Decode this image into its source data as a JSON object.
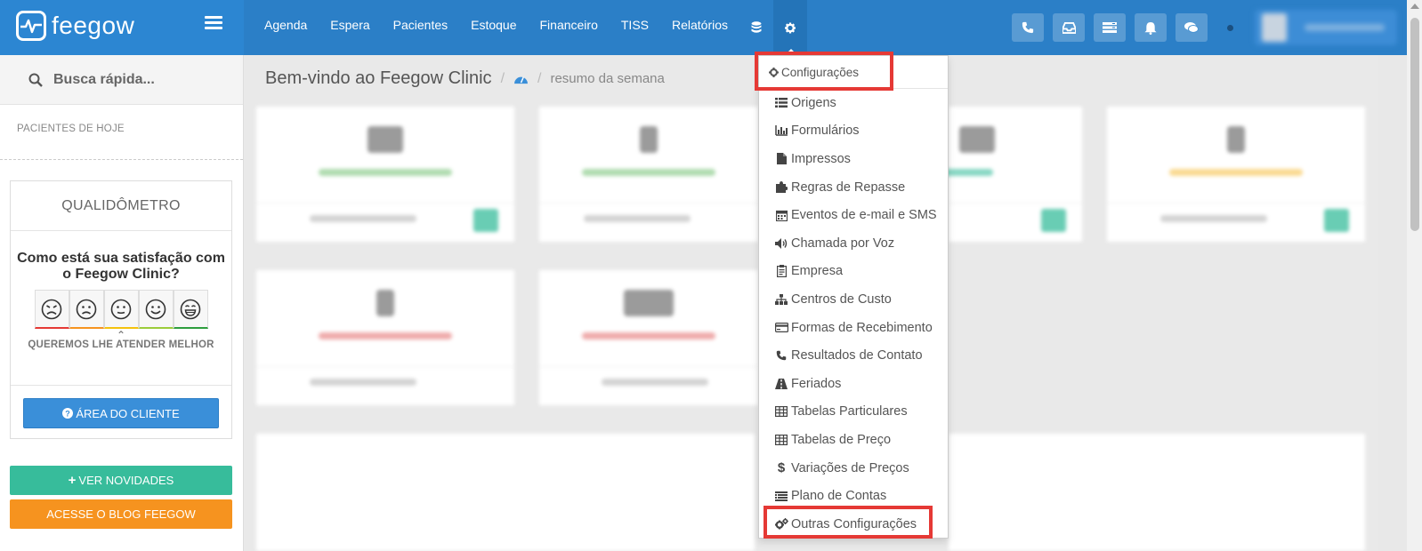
{
  "brand": {
    "name": "feegow"
  },
  "nav": {
    "items": [
      "Agenda",
      "Espera",
      "Pacientes",
      "Estoque",
      "Financeiro",
      "TISS",
      "Relatórios"
    ],
    "database_icon": "database-icon",
    "settings_icon": "gear-icon"
  },
  "topbar_icons": [
    "phone-icon",
    "inbox-icon",
    "list-icon",
    "bell-icon",
    "chat-icon"
  ],
  "sidebar": {
    "search_placeholder": "Busca rápida...",
    "today_patients_label": "PACIENTES DE HOJE",
    "qualimeter": {
      "title": "QUALIDÔMETRO",
      "question": "Como está sua satisfação com o Feegow Clinic?",
      "faces": [
        "very-dissatisfied",
        "dissatisfied",
        "neutral",
        "satisfied",
        "very-satisfied"
      ],
      "face_colors": [
        "#e53935",
        "#f6931f",
        "#f4c20d",
        "#9ccc3a",
        "#2e9e3e"
      ],
      "subtitle": "QUEREMOS LHE ATENDER MELHOR",
      "client_area_label": "ÁREA DO CLIENTE"
    },
    "news_label": "VER NOVIDADES",
    "blog_label": "ACESSE O BLOG FEEGOW"
  },
  "breadcrumb": {
    "title": "Bem-vindo ao Feegow Clinic",
    "subtitle": "resumo da semana"
  },
  "settings_menu": {
    "header": "Configurações",
    "items": [
      {
        "label": "Origens",
        "icon": "list-icon"
      },
      {
        "label": "Formulários",
        "icon": "bar-chart-icon"
      },
      {
        "label": "Impressos",
        "icon": "file-icon"
      },
      {
        "label": "Regras de Repasse",
        "icon": "puzzle-icon"
      },
      {
        "label": "Eventos de e-mail e SMS",
        "icon": "calendar-icon"
      },
      {
        "label": "Chamada por Voz",
        "icon": "volume-icon"
      },
      {
        "label": "Empresa",
        "icon": "clipboard-icon"
      },
      {
        "label": "Centros de Custo",
        "icon": "sitemap-icon"
      },
      {
        "label": "Formas de Recebimento",
        "icon": "credit-card-icon"
      },
      {
        "label": "Resultados de Contato",
        "icon": "phone-icon"
      },
      {
        "label": "Feriados",
        "icon": "road-icon"
      },
      {
        "label": "Tabelas Particulares",
        "icon": "table-icon"
      },
      {
        "label": "Tabelas de Preço",
        "icon": "table-icon"
      },
      {
        "label": "Variações de Preços",
        "icon": "dollar-icon"
      },
      {
        "label": "Plano de Contas",
        "icon": "list-alt-icon"
      },
      {
        "label": "Outras Configurações",
        "icon": "cogs-icon"
      }
    ],
    "highlighted": [
      "Configurações",
      "Outras Configurações"
    ],
    "highlight_color": "#e53935"
  },
  "colors": {
    "topbar": "#2b7fc7",
    "primary_button": "#3a8fd9",
    "success_button": "#37bc9b",
    "warning_button": "#f6931f"
  }
}
